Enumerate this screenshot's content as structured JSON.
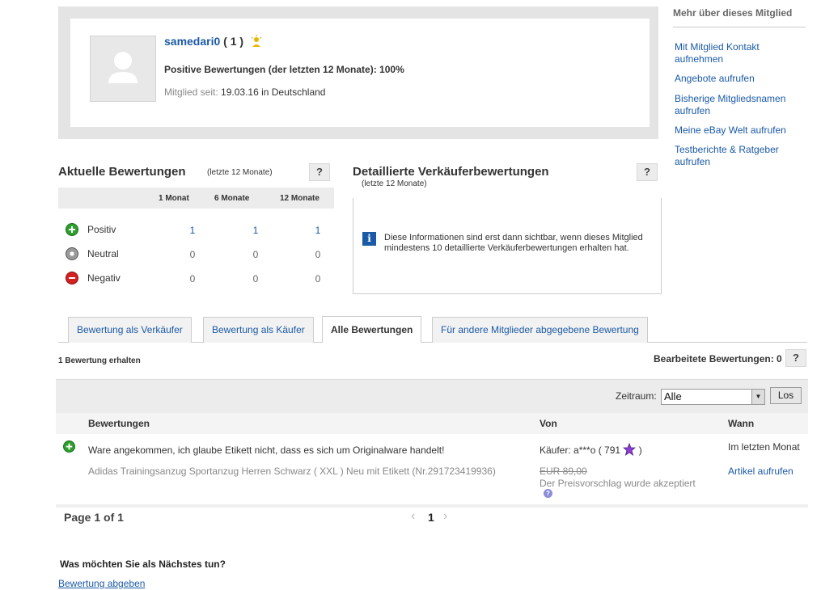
{
  "profile": {
    "username": "samedari0",
    "score": "( 1 )",
    "positive_text": "Positive Bewertungen (der letzten 12 Monate): 100%",
    "member_since_label": "Mitglied seit:",
    "member_since_value": "19.03.16 in Deutschland"
  },
  "sidebar": {
    "title": "Mehr über dieses Mitglied",
    "links": [
      "Mit Mitglied Kontakt aufnehmen",
      "Angebote aufrufen",
      "Bisherige Mitgliedsnamen aufrufen",
      "Meine eBay Welt aufrufen",
      "Testberichte & Ratgeber aufrufen"
    ]
  },
  "recent": {
    "title": "Aktuelle Bewertungen",
    "subtitle": "(letzte 12 Monate)",
    "help": "?",
    "columns": [
      "1 Monat",
      "6 Monate",
      "12 Monate"
    ],
    "rows": [
      {
        "label": "Positiv",
        "values": [
          "1",
          "1",
          "1"
        ],
        "color": "#2e9e2e"
      },
      {
        "label": "Neutral",
        "values": [
          "0",
          "0",
          "0"
        ],
        "color": "#8a8a8a"
      },
      {
        "label": "Negativ",
        "values": [
          "0",
          "0",
          "0"
        ],
        "color": "#d42020"
      }
    ]
  },
  "detailed": {
    "title": "Detaillierte Verkäuferbewertungen",
    "subtitle": "(letzte 12 Monate)",
    "help": "?",
    "info_icon": "i",
    "info_text": "Diese Informationen sind erst dann sichtbar, wenn dieses Mitglied mindestens 10 detaillierte Verkäuferbewertungen erhalten hat."
  },
  "tabs": [
    {
      "label": "Bewertung als Verkäufer",
      "active": false
    },
    {
      "label": "Bewertung als Käufer",
      "active": false
    },
    {
      "label": "Alle Bewertungen",
      "active": true
    },
    {
      "label": "Für andere Mitglieder abgegebene Bewertung",
      "active": false
    }
  ],
  "summary": {
    "count": "1 Bewertung erhalten",
    "edited": "Bearbeitete Bewertungen: 0",
    "help": "?"
  },
  "filter": {
    "label": "Zeitraum:",
    "selected": "Alle",
    "button": "Los"
  },
  "table": {
    "headers": [
      "Bewertungen",
      "Von",
      "Wann"
    ],
    "rows": [
      {
        "comment": "Ware angekommen, ich glaube Etikett nicht, dass es sich um Originalware handelt!",
        "item": "Adidas Trainingsanzug Sportanzug Herren Schwarz ( XXL ) Neu mit Etikett (Nr.291723419936)",
        "from": "Käufer: a***o ( 791",
        "from_close": ")",
        "price": "EUR 89,00",
        "accepted": "Der Preisvorschlag wurde akzeptiert",
        "when": "Im letzten Monat",
        "article_link": "Artikel aufrufen"
      }
    ]
  },
  "pagination": {
    "label": "Page 1 of 1",
    "current": "1",
    "prev": "‹",
    "next": "›"
  },
  "next_steps": {
    "title": "Was möchten Sie als Nächstes tun?",
    "link": "Bewertung abgeben"
  }
}
